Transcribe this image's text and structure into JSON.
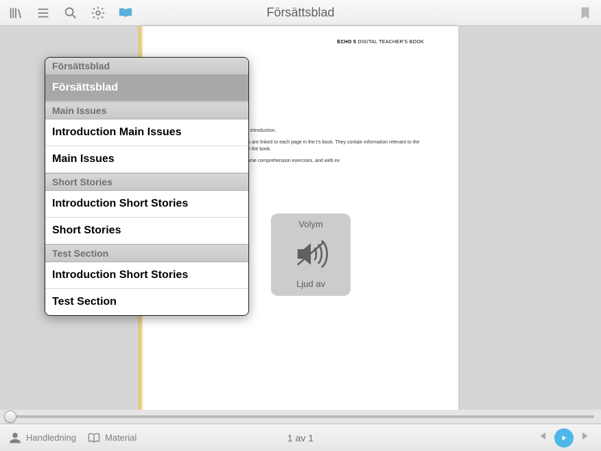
{
  "toolbar": {
    "title": "Försättsblad"
  },
  "page": {
    "header_bold": "ECHO 5",
    "header_rest": " DIGITAL TEACHER'S BOOK",
    "p1": "t work, please select a book or an introduction.",
    "p2": "all teacher's notes here. The notes are linked to each page in the t's book. They contain information relevant to the texts and exercises, move through the book.",
    "p3": "the worksheets are written first, some comprehension exercises, and web ex"
  },
  "popover": {
    "sections": [
      {
        "header": "Försättsblad",
        "items": [
          {
            "label": "Försättsblad",
            "selected": true
          }
        ]
      },
      {
        "header": "Main Issues",
        "items": [
          {
            "label": "Introduction Main Issues"
          },
          {
            "label": "Main Issues"
          }
        ]
      },
      {
        "header": "Short Stories",
        "items": [
          {
            "label": "Introduction Short Stories"
          },
          {
            "label": "Short Stories"
          }
        ]
      },
      {
        "header": "Test Section",
        "items": [
          {
            "label": "Introduction Short Stories"
          },
          {
            "label": "Test Section"
          }
        ]
      }
    ]
  },
  "volume": {
    "title": "Volym",
    "status": "Ljud av"
  },
  "bottom": {
    "handledning": "Handledning",
    "material": "Material",
    "page_indicator": "1 av 1"
  }
}
